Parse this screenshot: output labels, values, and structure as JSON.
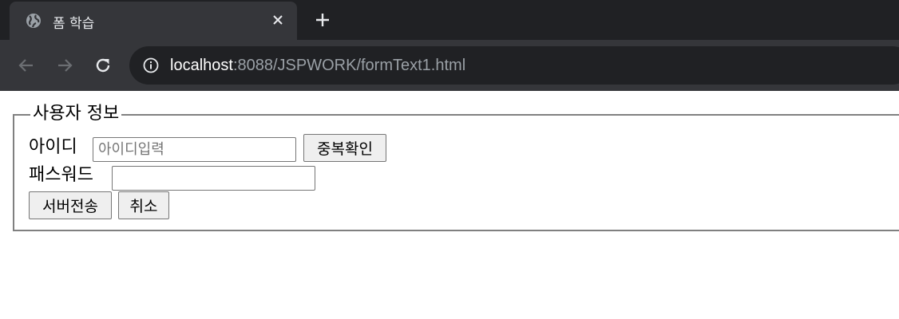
{
  "browser": {
    "tab": {
      "title": "폼 학습",
      "favicon": "globe-icon"
    },
    "url": {
      "host": "localhost",
      "rest": ":8088/JSPWORK/formText1.html"
    }
  },
  "form": {
    "legend": "사용자 정보",
    "id_label": "아이디",
    "id_placeholder": "아이디입력",
    "id_value": "",
    "check_button": "중복확인",
    "password_label": "패스워드",
    "password_value": "",
    "submit_button": "서버전송",
    "cancel_button": "취소"
  }
}
